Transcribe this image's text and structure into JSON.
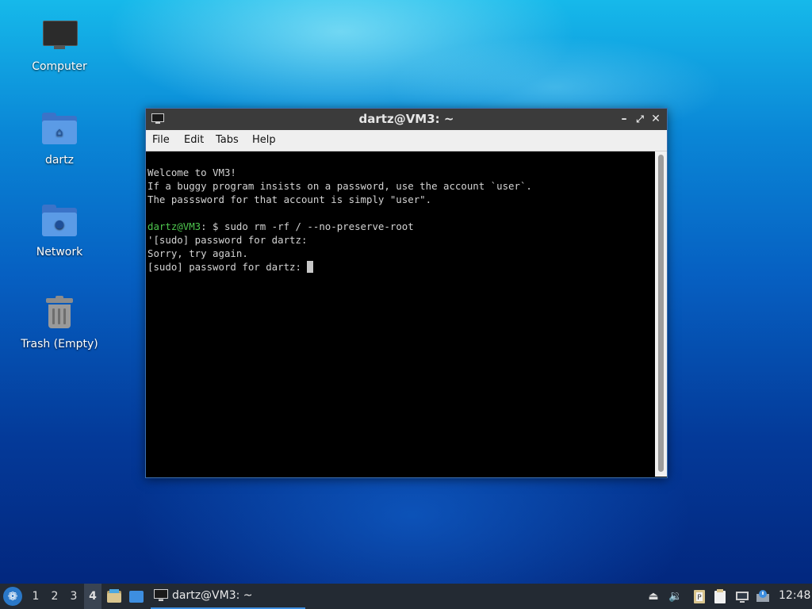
{
  "desktop": {
    "icons": [
      {
        "label": "Computer",
        "icon": "computer-icon"
      },
      {
        "label": "dartz",
        "icon": "home-folder-icon"
      },
      {
        "label": "Network",
        "icon": "network-folder-icon"
      },
      {
        "label": "Trash (Empty)",
        "icon": "trash-icon"
      }
    ]
  },
  "terminal": {
    "title": "dartz@VM3: ~",
    "menu": [
      "File",
      "Edit",
      "Tabs",
      "Help"
    ],
    "lines": {
      "l1": "Welcome to VM3!",
      "l2": "If a buggy program insists on a password, use the account `user`.",
      "l3": "The passsword for that account is simply \"user\".",
      "prompt_user": "dartz@VM3",
      "prompt_rest": ": $ sudo rm -rf / --no-preserve-root",
      "l5": "'[sudo] password for dartz:",
      "l6": "Sorry, try again.",
      "l7": "[sudo] password for dartz: "
    },
    "colors": {
      "prompt": "#4ec64e",
      "text": "#d3d3d3",
      "background": "#000000"
    }
  },
  "taskbar": {
    "workspaces": [
      "1",
      "2",
      "3",
      "4"
    ],
    "active_workspace": "4",
    "task": "dartz@VM3: ~",
    "clock": "12:48"
  }
}
